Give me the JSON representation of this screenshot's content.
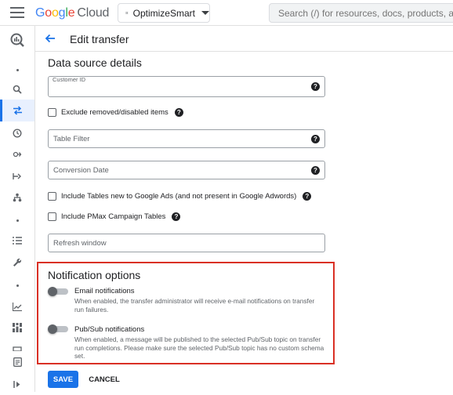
{
  "topbar": {
    "logo_letters": [
      "G",
      "o",
      "o",
      "g",
      "l",
      "e"
    ],
    "logo_suffix": "Cloud",
    "project_name": "OptimizeSmart",
    "search_placeholder": "Search (/) for resources, docs, products, and more"
  },
  "header": {
    "title": "Edit transfer"
  },
  "data_source": {
    "title": "Data source details",
    "customer_id_label": "Customer ID",
    "customer_id_value": "",
    "exclude_removed_label": "Exclude removed/disabled items",
    "table_filter_placeholder": "Table Filter",
    "conversion_date_placeholder": "Conversion Date",
    "include_new_tables_label": "Include Tables new to Google Ads (and not present in Google Adwords)",
    "include_pmax_label": "Include PMax Campaign Tables",
    "refresh_window_placeholder": "Refresh window"
  },
  "notifications": {
    "title": "Notification options",
    "email_title": "Email notifications",
    "email_desc": "When enabled, the transfer administrator will receive e-mail notifications on transfer run failures.",
    "pubsub_title": "Pub/Sub notifications",
    "pubsub_desc": "When enabled, a message will be published to the selected Pub/Sub topic on transfer run completions. Please make sure the selected Pub/Sub topic has no custom schema set."
  },
  "actions": {
    "save_label": "SAVE",
    "cancel_label": "CANCEL"
  },
  "colors": {
    "accent": "#1a73e8",
    "highlight_border": "#d93025"
  }
}
